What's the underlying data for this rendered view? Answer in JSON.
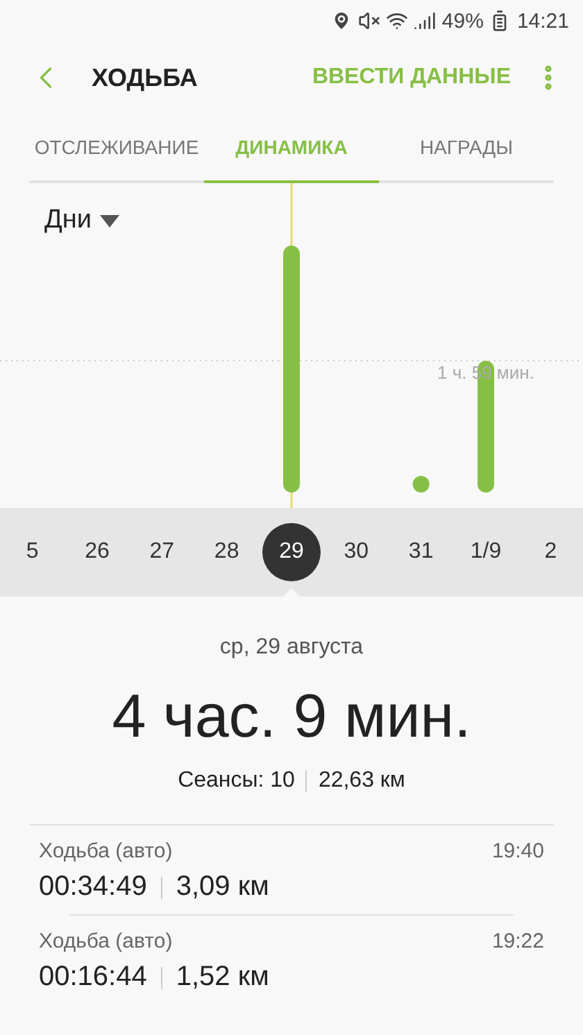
{
  "status_bar": {
    "battery": "49%",
    "time": "14:21"
  },
  "header": {
    "title": "ХОДЬБА",
    "action": "ВВЕСТИ ДАННЫЕ"
  },
  "tabs": [
    {
      "label": "ОТСЛЕЖИВАНИЕ",
      "selected": false
    },
    {
      "label": "ДИНАМИКА",
      "selected": true
    },
    {
      "label": "НАГРАДЫ",
      "selected": false
    }
  ],
  "period_dropdown": {
    "value": "Дни"
  },
  "chart": {
    "reference_label": "1 ч. 59 мин."
  },
  "days": [
    {
      "label": "5",
      "selected": false
    },
    {
      "label": "26",
      "selected": false
    },
    {
      "label": "27",
      "selected": false
    },
    {
      "label": "28",
      "selected": false
    },
    {
      "label": "29",
      "selected": true
    },
    {
      "label": "30",
      "selected": false
    },
    {
      "label": "31",
      "selected": false
    },
    {
      "label": "1/9",
      "selected": false
    },
    {
      "label": "2",
      "selected": false
    }
  ],
  "summary": {
    "date": "ср, 29 августа",
    "total": "4 час. 9 мин.",
    "sessions": "Сеансы: 10",
    "distance": "22,63 км"
  },
  "sessions": [
    {
      "name": "Ходьба (авто)",
      "time": "19:40",
      "duration": "00:34:49",
      "distance": "3,09 км"
    },
    {
      "name": "Ходьба (авто)",
      "time": "19:22",
      "duration": "00:16:44",
      "distance": "1,52 км"
    }
  ]
}
